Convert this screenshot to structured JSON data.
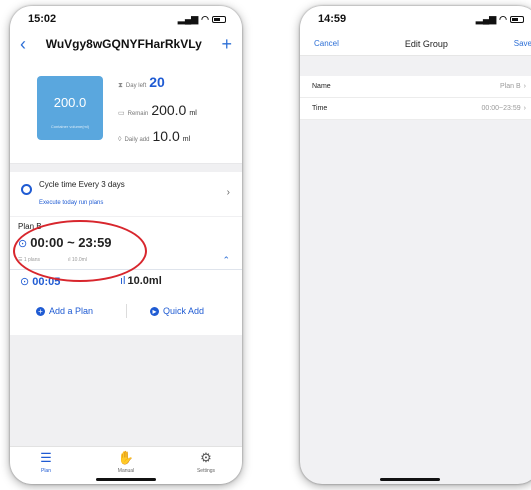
{
  "left": {
    "status": {
      "time": "15:02"
    },
    "nav": {
      "title": "WuVgy8wGQNYFHarRkVLy",
      "back_icon": "chevron-left-icon",
      "add_icon": "plus-icon"
    },
    "container": {
      "value": "200.0",
      "label": "Container volume(ml)"
    },
    "stats": {
      "day_left_label": "Day left",
      "day_left_value": "20",
      "remain_label": "Remain",
      "remain_value": "200.0",
      "remain_unit": "ml",
      "daily_add_label": "Daily add",
      "daily_add_value": "10.0",
      "daily_add_unit": "ml"
    },
    "cycle": {
      "title": "Cycle time   Every 3 days",
      "subtitle": "Execute today run plans"
    },
    "plan": {
      "name": "Plan B",
      "time_range": "00:00 ~ 23:59",
      "plans_count": "1 plans",
      "amount": "10.0ml"
    },
    "entry": {
      "time": "00:05",
      "amount": "10.0ml"
    },
    "actions": {
      "add_plan": "Add a Plan",
      "quick_add": "Quick Add"
    },
    "tabs": [
      {
        "label": "Plan",
        "icon": "list-icon"
      },
      {
        "label": "Manual",
        "icon": "hand-icon"
      },
      {
        "label": "Settings",
        "icon": "gear-icon"
      }
    ],
    "annotation_color": "#d8262d"
  },
  "right": {
    "status": {
      "time": "14:59"
    },
    "nav": {
      "cancel": "Cancel",
      "title": "Edit Group",
      "save": "Save"
    },
    "form": [
      {
        "label": "Name",
        "value": "Plan B"
      },
      {
        "label": "Time",
        "value": "00:00~23:59"
      }
    ]
  },
  "accent_color": "#1f5bd3"
}
